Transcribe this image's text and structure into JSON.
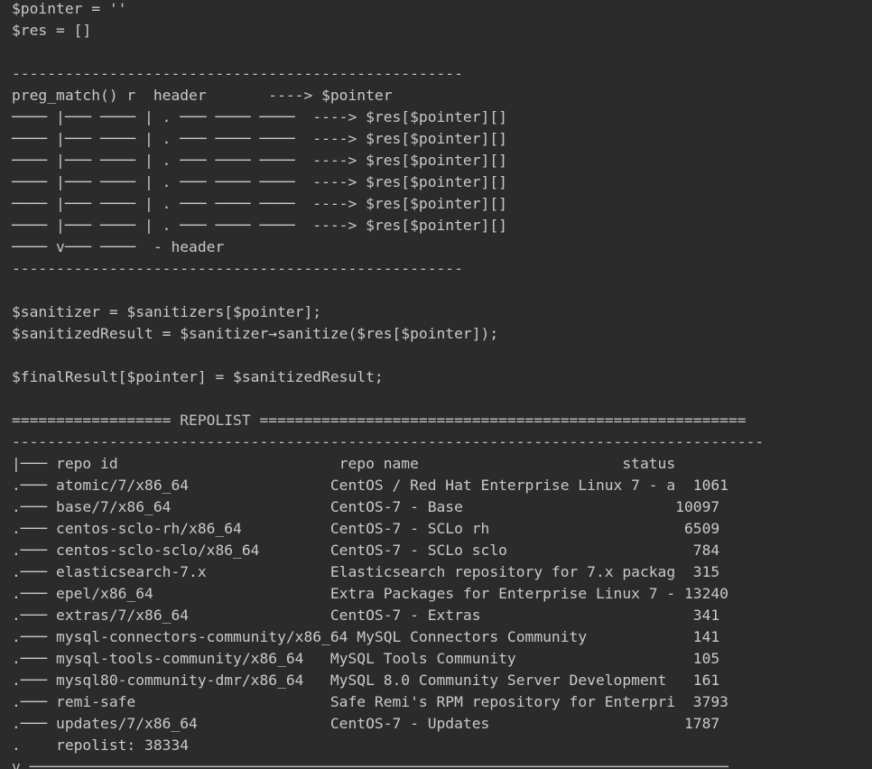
{
  "editor": {
    "lines": [
      "$pointer = ''",
      "$res = []",
      "",
      "---------------------------------------------------",
      "preg_match() r  header       ----> $pointer",
      "──── |─── ──── | . ─── ──── ────  ----> $res[$pointer][]",
      "──── |─── ──── | . ─── ──── ────  ----> $res[$pointer][]",
      "──── |─── ──── | . ─── ──── ────  ----> $res[$pointer][]",
      "──── |─── ──── | . ─── ──── ────  ----> $res[$pointer][]",
      "──── |─── ──── | . ─── ──── ────  ----> $res[$pointer][]",
      "──── |─── ──── | . ─── ──── ────  ----> $res[$pointer][]",
      "──── v─── ────  - header",
      "---------------------------------------------------",
      "",
      "$sanitizer = $sanitizers[$pointer];",
      "$sanitizedResult = $sanitizer→sanitize($res[$pointer]);",
      "",
      "$finalResult[$pointer] = $sanitizedResult;",
      "",
      "================== REPOLIST =======================================================",
      "-------------------------------------------------------------------------------------",
      "|─── repo id                         repo name                       status",
      ".─── atomic/7/x86_64                CentOS / Red Hat Enterprise Linux 7 - a  1061",
      ".─── base/7/x86_64                  CentOS-7 - Base                        10097",
      ".─── centos-sclo-rh/x86_64          CentOS-7 - SCLo rh                      6509",
      ".─── centos-sclo-sclo/x86_64        CentOS-7 - SCLo sclo                     784",
      ".─── elasticsearch-7.x              Elasticsearch repository for 7.x packag  315",
      ".─── epel/x86_64                    Extra Packages for Enterprise Linux 7 - 13240",
      ".─── extras/7/x86_64                CentOS-7 - Extras                        341",
      ".─── mysql-connectors-community/x86_64 MySQL Connectors Community            141",
      ".─── mysql-tools-community/x86_64   MySQL Tools Community                    105",
      ".─── mysql80-community-dmr/x86_64   MySQL 8.0 Community Server Development   161",
      ".─── remi-safe                      Safe Remi's RPM repository for Enterpri  3793",
      ".─── updates/7/x86_64               CentOS-7 - Updates                      1787",
      ".    repolist: 38334",
      "v ───────────────────────────────────────────────────────────────────────────────"
    ]
  },
  "colors": {
    "background": "#2b2b2b",
    "text": "#c9c9c9",
    "squiggle": "#6a8759"
  }
}
